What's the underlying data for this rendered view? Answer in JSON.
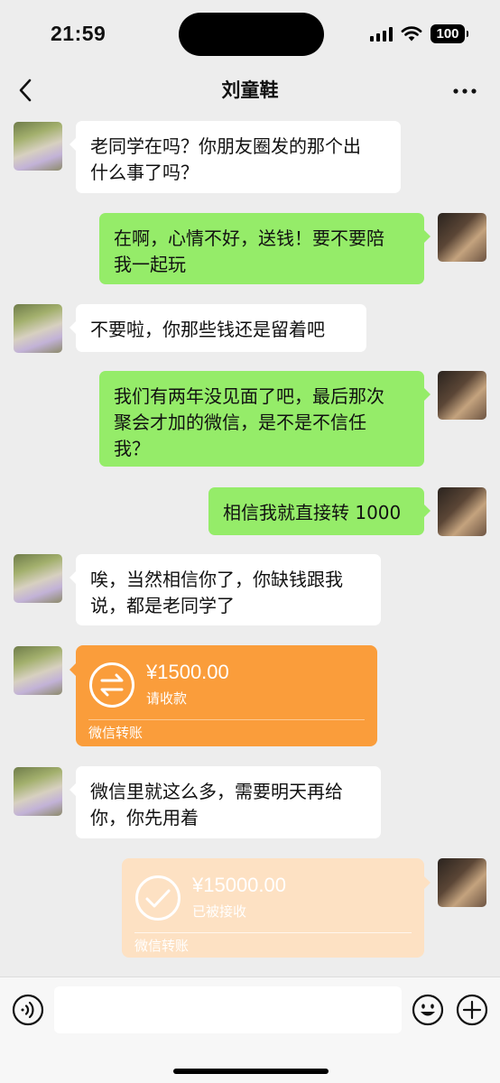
{
  "status_bar": {
    "time": "21:59",
    "battery": "100"
  },
  "chat": {
    "title": "刘童鞋"
  },
  "messages": [
    {
      "from": "friend",
      "text": "老同学在吗？你朋友圈发的那个出\n什么事了吗？"
    },
    {
      "from": "me",
      "text": "在啊，心情不好，送钱！要不要陪\n我一起玩"
    },
    {
      "from": "friend",
      "text": "不要啦，你那些钱还是留着吧"
    },
    {
      "from": "me",
      "text": "我们有两年没见面了吧，最后那次\n聚会才加的微信，是不是不信任\n我？"
    },
    {
      "from": "me",
      "text": "相信我就直接转 1000"
    },
    {
      "from": "friend",
      "text": "唉，当然相信你了，你缺钱跟我\n说，都是老同学了"
    },
    {
      "from": "friend",
      "type": "transfer",
      "amount": "¥1500.00",
      "status": "请收款",
      "label": "微信转账",
      "color": "#fa9d3b"
    },
    {
      "from": "friend",
      "text": "微信里就这么多，需要明天再给\n你，你先用着"
    },
    {
      "from": "me",
      "type": "transfer",
      "amount": "¥15000.00",
      "status": "已被接收",
      "label": "微信转账",
      "color": "#fde1c3"
    }
  ],
  "icons": {
    "back": "chevron-left-icon",
    "more": "more-dots-icon",
    "voice": "voice-icon",
    "emoji": "emoji-icon",
    "plus": "plus-icon",
    "transfer_pending": "transfer-arrows-icon",
    "transfer_done": "check-circle-icon"
  },
  "colors": {
    "outgoing_bubble": "#95ec69",
    "incoming_bubble": "#ffffff",
    "background": "#ededed"
  },
  "input": {
    "value": ""
  }
}
